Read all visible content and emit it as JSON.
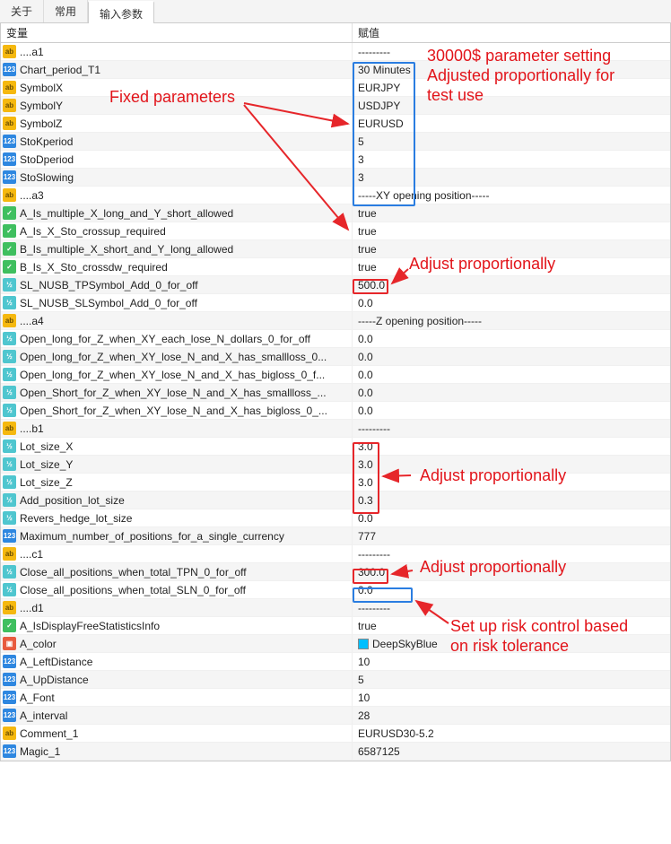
{
  "tabs": {
    "t0": "关于",
    "t1": "常用",
    "t2": "输入参数"
  },
  "header": {
    "var": "变量",
    "val": "赋值"
  },
  "rows": [
    {
      "ic": "ab",
      "name": "....a1",
      "val": "---------"
    },
    {
      "ic": "int",
      "name": "Chart_period_T1",
      "val": "30 Minutes"
    },
    {
      "ic": "ab",
      "name": "SymbolX",
      "val": "EURJPY"
    },
    {
      "ic": "ab",
      "name": "SymbolY",
      "val": "USDJPY"
    },
    {
      "ic": "ab",
      "name": "SymbolZ",
      "val": "EURUSD"
    },
    {
      "ic": "int",
      "name": "StoKperiod",
      "val": "5"
    },
    {
      "ic": "int",
      "name": "StoDperiod",
      "val": "3"
    },
    {
      "ic": "int",
      "name": "StoSlowing",
      "val": "3"
    },
    {
      "ic": "ab",
      "name": "....a3",
      "val": "-----XY opening position-----"
    },
    {
      "ic": "bool",
      "name": "A_Is_multiple_X_long_and_Y_short_allowed",
      "val": "true"
    },
    {
      "ic": "bool",
      "name": "A_Is_X_Sto_crossup_required",
      "val": "true"
    },
    {
      "ic": "bool",
      "name": "B_Is_multiple_X_short_and_Y_long_allowed",
      "val": "true"
    },
    {
      "ic": "bool",
      "name": "B_Is_X_Sto_crossdw_required",
      "val": "true"
    },
    {
      "ic": "dbl",
      "name": "SL_NUSB_TPSymbol_Add_0_for_off",
      "val": "500.0"
    },
    {
      "ic": "dbl",
      "name": "SL_NUSB_SLSymbol_Add_0_for_off",
      "val": "0.0"
    },
    {
      "ic": "ab",
      "name": "....a4",
      "val": "-----Z opening position-----"
    },
    {
      "ic": "dbl",
      "name": "Open_long_for_Z_when_XY_each_lose_N_dollars_0_for_off",
      "val": "0.0"
    },
    {
      "ic": "dbl",
      "name": "Open_long_for_Z_when_XY_lose_N_and_X_has_smallloss_0...",
      "val": "0.0"
    },
    {
      "ic": "dbl",
      "name": "Open_long_for_Z_when_XY_lose_N_and_X_has_bigloss_0_f...",
      "val": "0.0"
    },
    {
      "ic": "dbl",
      "name": "Open_Short_for_Z_when_XY_lose_N_and_X_has_smallloss_...",
      "val": "0.0"
    },
    {
      "ic": "dbl",
      "name": "Open_Short_for_Z_when_XY_lose_N_and_X_has_bigloss_0_...",
      "val": "0.0"
    },
    {
      "ic": "ab",
      "name": "....b1",
      "val": "---------"
    },
    {
      "ic": "dbl",
      "name": "Lot_size_X",
      "val": "3.0"
    },
    {
      "ic": "dbl",
      "name": "Lot_size_Y",
      "val": "3.0"
    },
    {
      "ic": "dbl",
      "name": "Lot_size_Z",
      "val": "3.0"
    },
    {
      "ic": "dbl",
      "name": "Add_position_lot_size",
      "val": "0.3"
    },
    {
      "ic": "dbl",
      "name": "Revers_hedge_lot_size",
      "val": "0.0"
    },
    {
      "ic": "int",
      "name": "Maximum_number_of_positions_for_a_single_currency",
      "val": "777"
    },
    {
      "ic": "ab",
      "name": "....c1",
      "val": "---------"
    },
    {
      "ic": "dbl",
      "name": "Close_all_positions_when_total_TPN_0_for_off",
      "val": "300.0"
    },
    {
      "ic": "dbl",
      "name": "Close_all_positions_when_total_SLN_0_for_off",
      "val": "0.0"
    },
    {
      "ic": "ab",
      "name": "....d1",
      "val": "---------"
    },
    {
      "ic": "bool",
      "name": "A_IsDisplayFreeStatisticsInfo",
      "val": "true"
    },
    {
      "ic": "col",
      "name": "A_color",
      "val": "DeepSkyBlue"
    },
    {
      "ic": "int",
      "name": "A_LeftDistance",
      "val": "10"
    },
    {
      "ic": "int",
      "name": "A_UpDistance",
      "val": "5"
    },
    {
      "ic": "int",
      "name": "A_Font",
      "val": "10"
    },
    {
      "ic": "int",
      "name": "A_interval",
      "val": "28"
    },
    {
      "ic": "ab",
      "name": "Comment_1",
      "val": "EURUSD30-5.2"
    },
    {
      "ic": "int",
      "name": "Magic_1",
      "val": "6587125"
    }
  ],
  "annot": {
    "fixed": "Fixed parameters",
    "topA": "30000$ parameter setting",
    "topB": "Adjusted proportionally for",
    "topC": "test use",
    "ap1": "Adjust proportionally",
    "ap2": "Adjust proportionally",
    "ap3": "Adjust proportionally",
    "riskA": "Set up risk control based",
    "riskB": "on risk tolerance"
  },
  "iconText": {
    "ab": "ab",
    "int": "123",
    "bool": "✓",
    "dbl": "½",
    "col": "▣"
  }
}
